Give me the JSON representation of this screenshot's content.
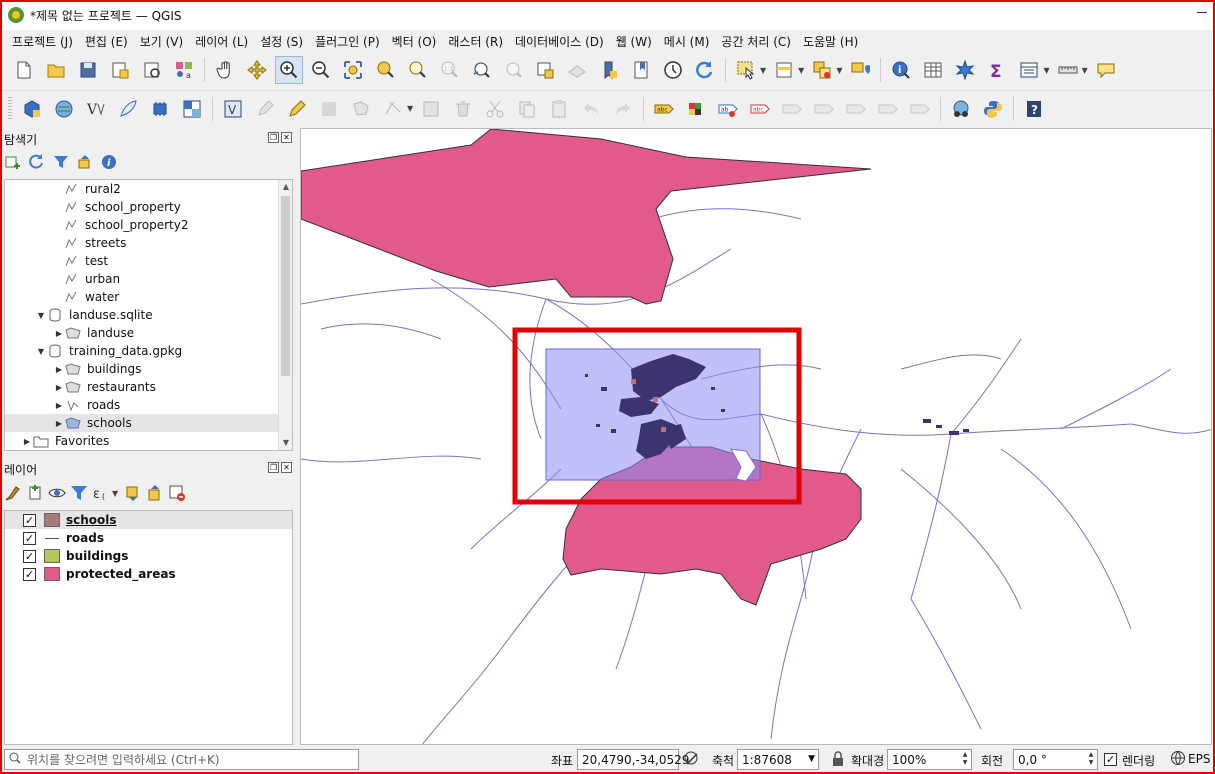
{
  "window": {
    "title": "*제목 없는 프로젝트 — QGIS"
  },
  "menu": {
    "items": [
      "프로젝트 (J)",
      "편집 (E)",
      "보기 (V)",
      "레이어 (L)",
      "설정 (S)",
      "플러그인 (P)",
      "벡터 (O)",
      "래스터 (R)",
      "데이터베이스 (D)",
      "웹 (W)",
      "메시 (M)",
      "공간 처리 (C)",
      "도움말 (H)"
    ]
  },
  "browser": {
    "title": "탐색기",
    "items": [
      {
        "label": "rural2",
        "icon": "line-layer-icon"
      },
      {
        "label": "school_property",
        "icon": "line-layer-icon"
      },
      {
        "label": "school_property2",
        "icon": "line-layer-icon"
      },
      {
        "label": "streets",
        "icon": "line-layer-icon"
      },
      {
        "label": "test",
        "icon": "line-layer-icon"
      },
      {
        "label": "urban",
        "icon": "line-layer-icon"
      },
      {
        "label": "water",
        "icon": "line-layer-icon"
      },
      {
        "label": "landuse.sqlite",
        "icon": "database-icon"
      },
      {
        "label": "landuse",
        "icon": "polygon-layer-icon"
      },
      {
        "label": "training_data.gpkg",
        "icon": "database-icon"
      },
      {
        "label": "buildings",
        "icon": "polygon-layer-icon"
      },
      {
        "label": "restaurants",
        "icon": "polygon-layer-icon"
      },
      {
        "label": "roads",
        "icon": "line-layer-icon"
      },
      {
        "label": "schools",
        "icon": "polygon-layer-icon"
      },
      {
        "label": "Favorites",
        "icon": "folder-icon"
      }
    ]
  },
  "layers": {
    "title": "레이어",
    "items": [
      {
        "name": "schools",
        "checked": true,
        "color": "#a9787a",
        "type": "polygon"
      },
      {
        "name": "roads",
        "checked": true,
        "color": "#555555",
        "type": "line"
      },
      {
        "name": "buildings",
        "checked": true,
        "color": "#b5c95a",
        "type": "polygon"
      },
      {
        "name": "protected_areas",
        "checked": true,
        "color": "#e25a8b",
        "type": "polygon"
      }
    ]
  },
  "map": {
    "protected_color": "#e25a8b",
    "roads_color": "#7a73c9",
    "highlight_fill": "#8f8cf5",
    "buildings_color": "#3b3470",
    "annotation_color": "#e00000"
  },
  "status": {
    "locator_placeholder": "위치를 찾으려면 입력하세요 (Ctrl+K)",
    "coord_label": "좌표",
    "coord_value": "20,4790,-34,0529",
    "scale_label": "축척",
    "scale_value": "1:87608",
    "magnifier_label": "확대경",
    "magnifier_value": "100%",
    "rotation_label": "회전",
    "rotation_value": "0,0 °",
    "render_label": "렌더링",
    "crs_label": "EPS"
  }
}
